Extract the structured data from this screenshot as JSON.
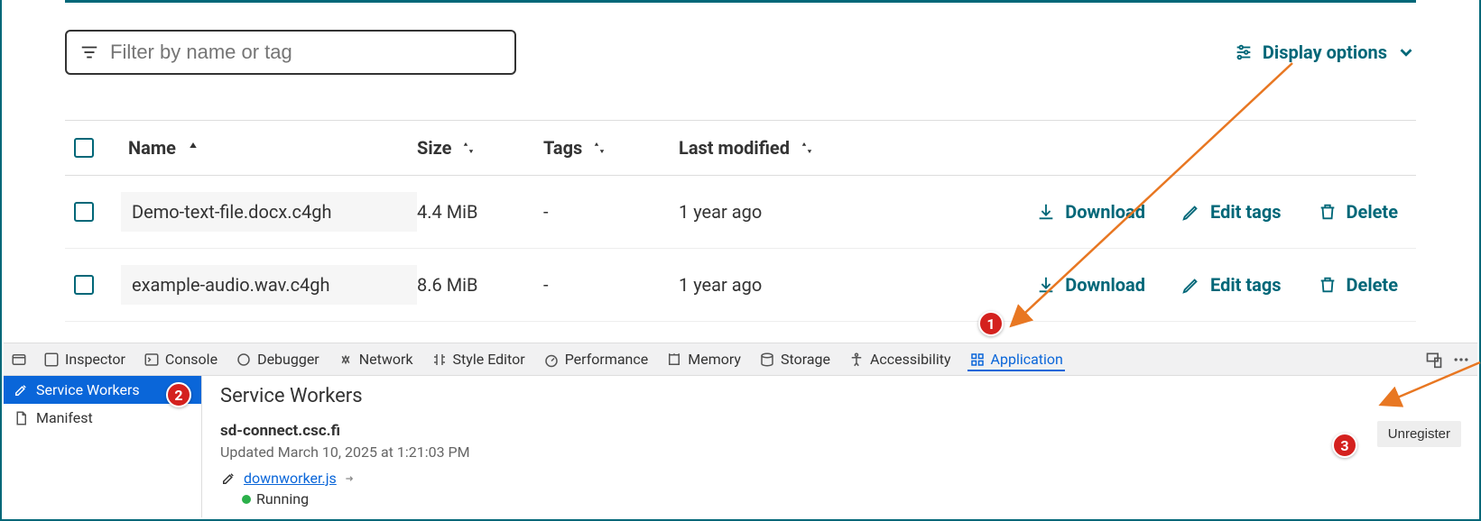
{
  "filter": {
    "placeholder": "Filter by name or tag"
  },
  "display_options": "Display options",
  "table": {
    "headers": {
      "name": "Name",
      "size": "Size",
      "tags": "Tags",
      "modified": "Last modified"
    },
    "rows": [
      {
        "name": "Demo-text-file.docx.c4gh",
        "size": "4.4 MiB",
        "tags": "-",
        "modified": "1 year ago"
      },
      {
        "name": "example-audio.wav.c4gh",
        "size": "8.6 MiB",
        "tags": "-",
        "modified": "1 year ago"
      }
    ],
    "actions": {
      "download": "Download",
      "edit": "Edit tags",
      "delete": "Delete"
    }
  },
  "devtools": {
    "tabs": [
      "Inspector",
      "Console",
      "Debugger",
      "Network",
      "Style Editor",
      "Performance",
      "Memory",
      "Storage",
      "Accessibility",
      "Application"
    ],
    "active_tab": "Application",
    "sidebar": [
      {
        "label": "Service Workers",
        "active": true
      },
      {
        "label": "Manifest",
        "active": false
      }
    ],
    "sw": {
      "title": "Service Workers",
      "host": "sd-connect.csc.fi",
      "updated": "Updated March 10, 2025 at 1:21:03 PM",
      "worker": "downworker.js",
      "running": "Running",
      "unregister": "Unregister"
    }
  },
  "annotations": {
    "b1": "1",
    "b2": "2",
    "b3": "3"
  }
}
